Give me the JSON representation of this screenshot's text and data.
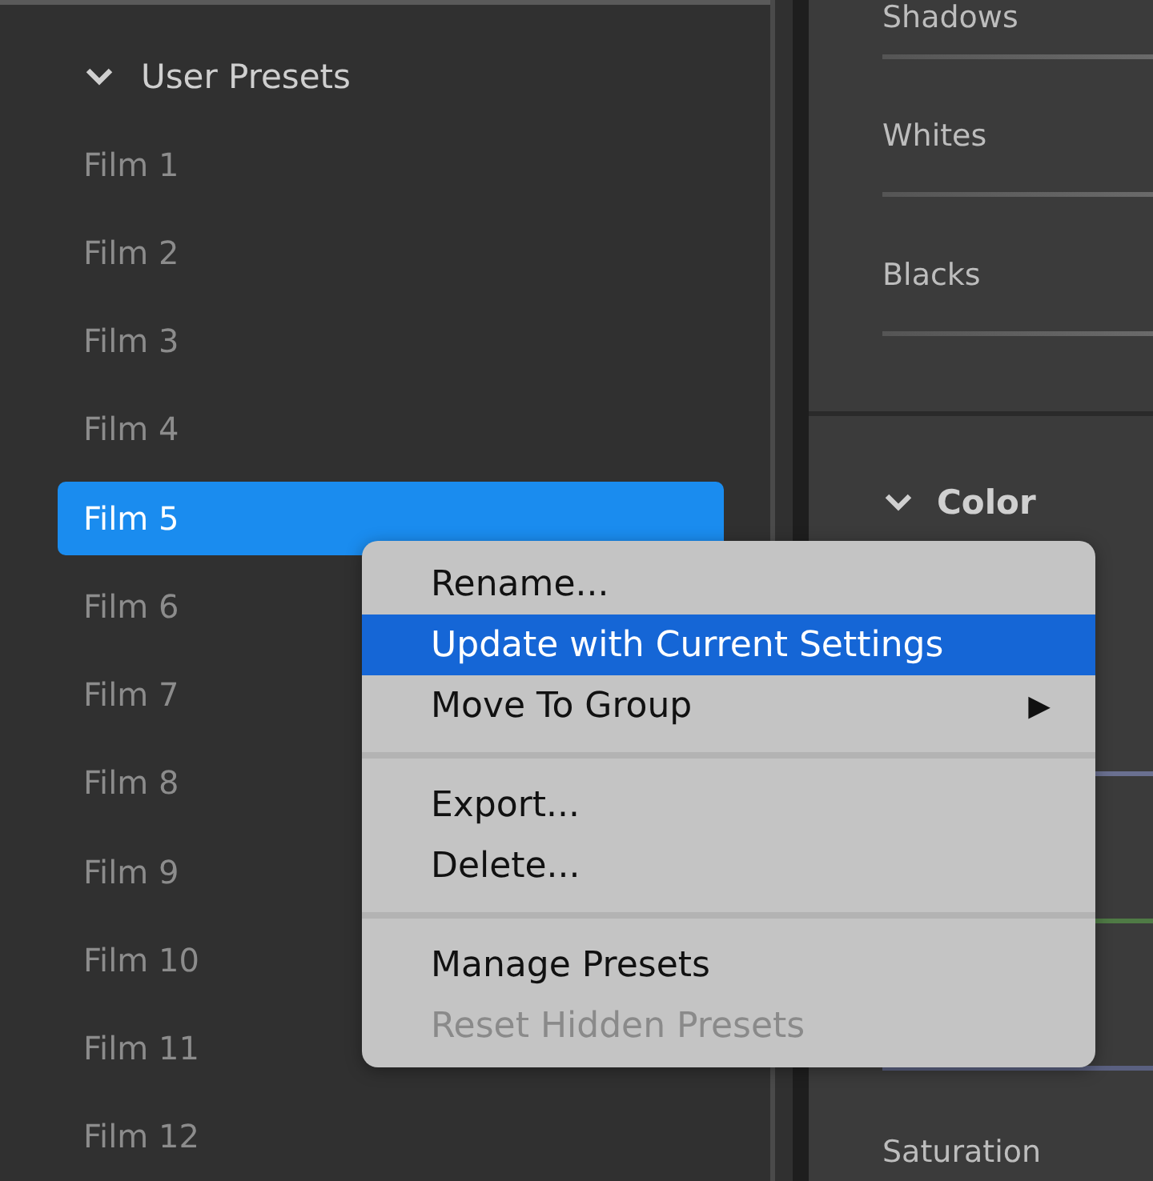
{
  "presets": {
    "group": {
      "label": "User Presets",
      "expanded": true
    },
    "items": [
      {
        "label": "Film 1",
        "selected": false
      },
      {
        "label": "Film 2",
        "selected": false
      },
      {
        "label": "Film 3",
        "selected": false
      },
      {
        "label": "Film 4",
        "selected": false
      },
      {
        "label": "Film 5",
        "selected": true
      },
      {
        "label": "Film 6",
        "selected": false
      },
      {
        "label": "Film 7",
        "selected": false
      },
      {
        "label": "Film 8",
        "selected": false
      },
      {
        "label": "Film 9",
        "selected": false
      },
      {
        "label": "Film 10",
        "selected": false
      },
      {
        "label": "Film 11",
        "selected": false
      },
      {
        "label": "Film 12",
        "selected": false
      }
    ]
  },
  "adjustments": {
    "tone_sliders": [
      {
        "label": "Shadows"
      },
      {
        "label": "Whites"
      },
      {
        "label": "Blacks"
      }
    ],
    "color_section": {
      "label": "Color",
      "expanded": true
    },
    "color_sliders": [
      {
        "color": "#6a7090"
      },
      {
        "color": "#4f7a45"
      },
      {
        "color": "#5a6080"
      }
    ],
    "saturation": {
      "label": "Saturation"
    }
  },
  "context_menu": {
    "sections": [
      [
        {
          "label": "Rename...",
          "selected": false,
          "disabled": false
        },
        {
          "label": "Update with Current Settings",
          "selected": true,
          "disabled": false
        },
        {
          "label": "Move To Group",
          "selected": false,
          "disabled": false,
          "submenu_glyph": "▶"
        }
      ],
      [
        {
          "label": "Export...",
          "selected": false,
          "disabled": false
        },
        {
          "label": "Delete...",
          "selected": false,
          "disabled": false
        }
      ],
      [
        {
          "label": "Manage Presets",
          "selected": false,
          "disabled": false
        },
        {
          "label": "Reset Hidden Presets",
          "selected": false,
          "disabled": true
        }
      ]
    ]
  }
}
